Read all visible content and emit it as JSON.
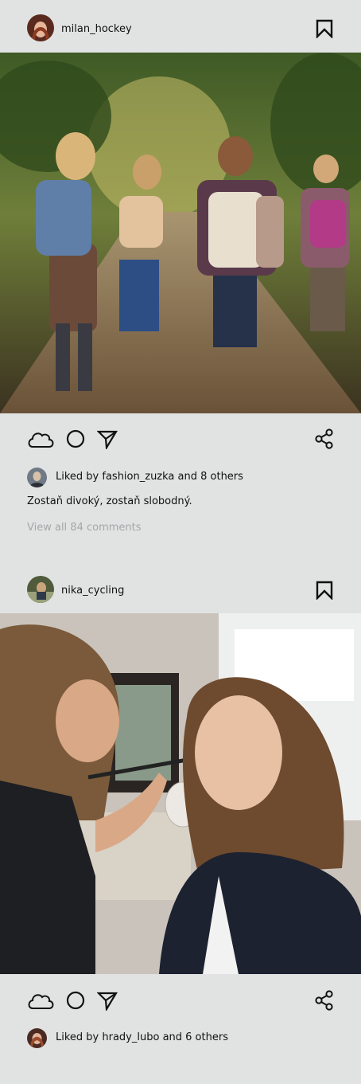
{
  "posts": [
    {
      "username": "milan_hockey",
      "likes_text": "Liked by fashion_zuzka and 8 others",
      "caption": "Zostaň divoký, zostaň slobodný.",
      "view_comments": "View all 84 comments"
    },
    {
      "username": "nika_cycling",
      "likes_text": "Liked by hrady_lubo and 6 others"
    }
  ],
  "icons": {
    "bookmark": "bookmark-icon",
    "like": "cloud-like-icon",
    "comment": "circle-comment-icon",
    "send": "send-arrow-icon",
    "share": "share-icon"
  },
  "colors": {
    "background": "#e1e3e3",
    "text": "#111111",
    "muted": "#a3a7a8"
  }
}
